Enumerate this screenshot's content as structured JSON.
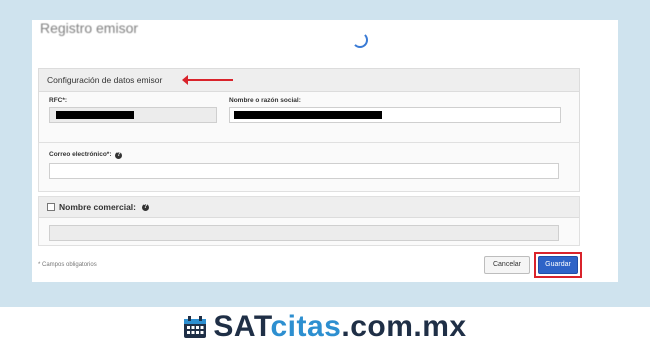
{
  "form": {
    "title": "Registro emisor",
    "section_title": "Configuración de datos emisor",
    "rfc_label": "RFC*:",
    "name_label": "Nombre o razón social:",
    "email_label": "Correo electrónico*:",
    "commercial_name_label": "Nombre comercial:",
    "required_note": "* Campos obligatorios",
    "cancel_label": "Cancelar",
    "save_label": "Guardar"
  },
  "brand": {
    "part1": "SAT",
    "part2": "citas",
    "part3": ".com.mx"
  },
  "colors": {
    "accent_red": "#d9232b",
    "button_blue": "#2e63c7",
    "brand_dark": "#1f2f46",
    "brand_blue": "#2d8fd0"
  }
}
